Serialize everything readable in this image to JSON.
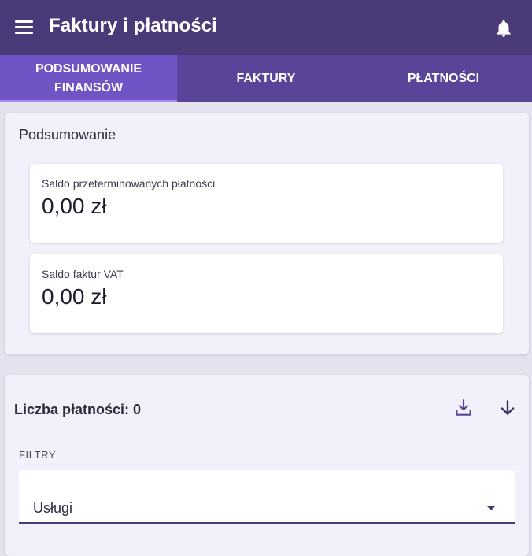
{
  "appbar": {
    "title": "Faktury i płatności",
    "menu_icon": "menu-icon",
    "notifications_icon": "bell-icon",
    "background": "#4a3a78"
  },
  "tabs": [
    {
      "label": "PODSUMOWANIE FINANSÓW",
      "active": true
    },
    {
      "label": "FAKTURY",
      "active": false
    },
    {
      "label": "PŁATNOŚCI",
      "active": false
    }
  ],
  "summary": {
    "title": "Podsumowanie",
    "overdue": {
      "label": "Saldo przeterminowanych płatności",
      "value": "0,00 zł"
    },
    "vat": {
      "label": "Saldo faktur VAT",
      "value": "0,00 zł"
    }
  },
  "payments": {
    "count_text": "Liczba płatności: 0",
    "download_icon": "download-icon",
    "sort_icon": "arrow-down-icon",
    "filters_label": "FILTRY",
    "filter_select": {
      "value": "Usługi"
    }
  },
  "colors": {
    "accent": "#4a3a78",
    "tab_bar": "#5a449a",
    "tab_active": "#7053c4"
  }
}
